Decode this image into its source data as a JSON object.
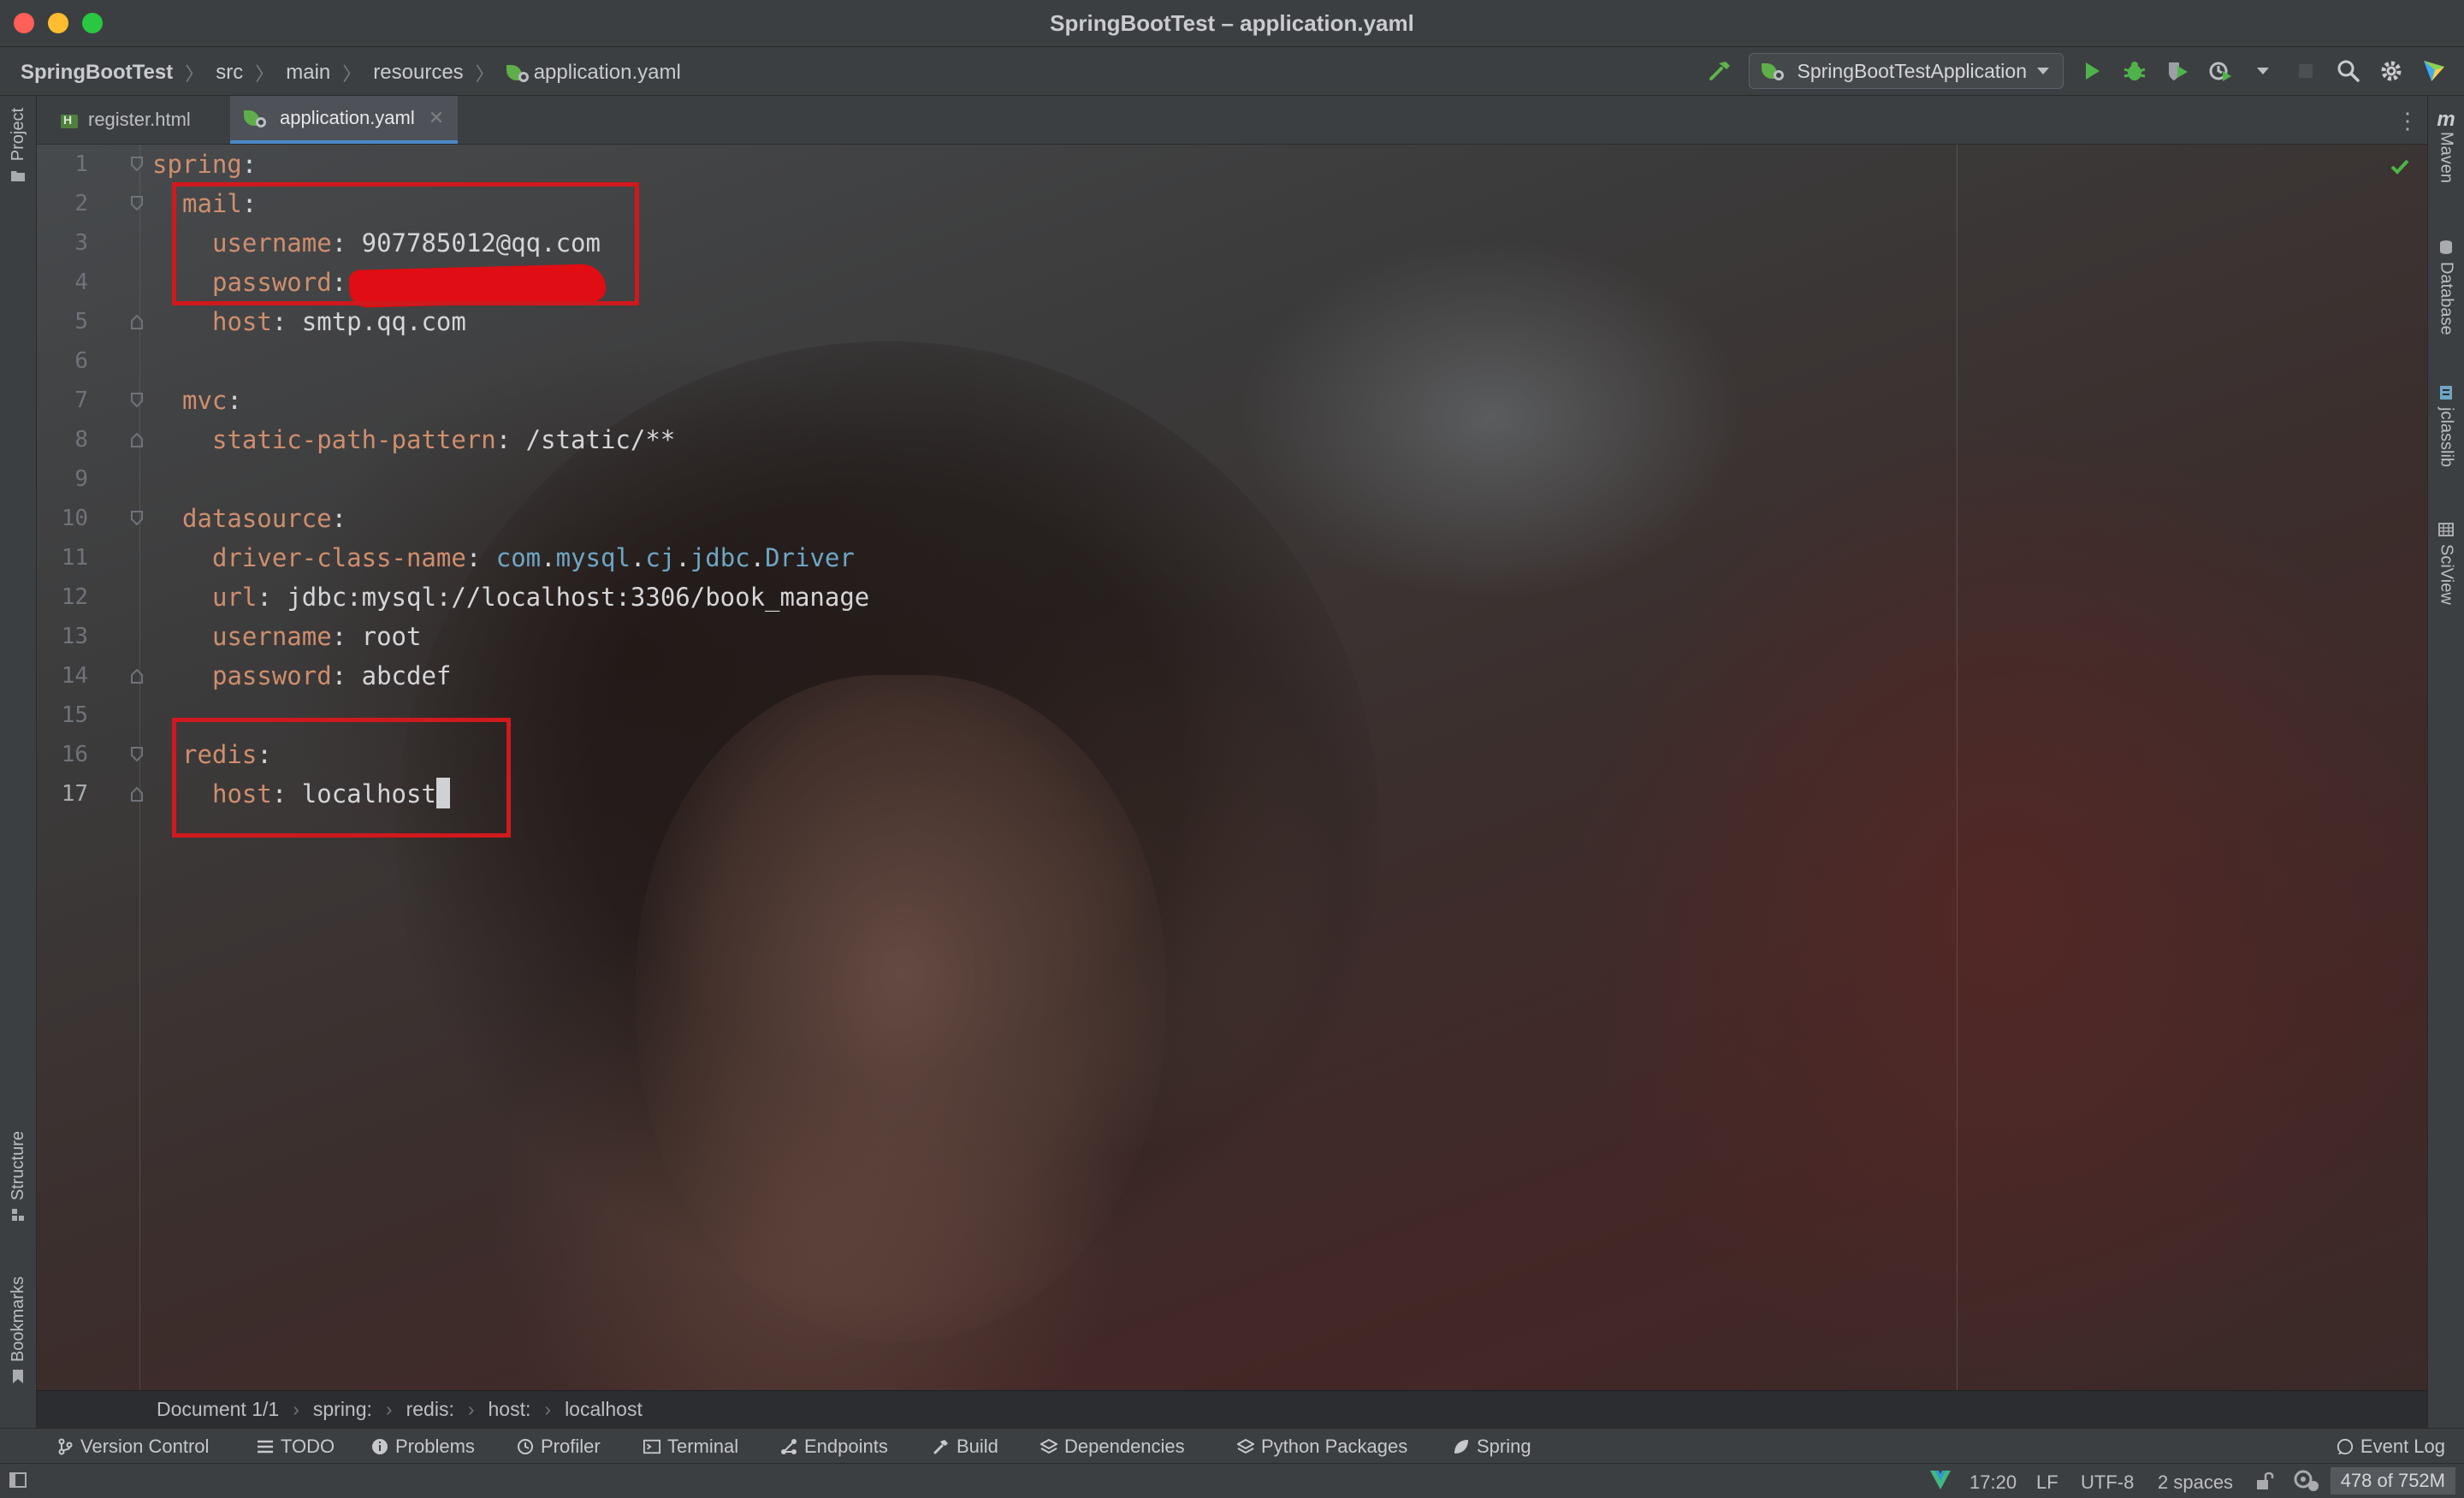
{
  "window": {
    "title": "SpringBootTest – application.yaml"
  },
  "navbar": {
    "breadcrumbs": [
      "SpringBootTest",
      "src",
      "main",
      "resources",
      "application.yaml"
    ],
    "run_config": "SpringBootTestApplication"
  },
  "left_tools": {
    "project": "Project",
    "structure": "Structure",
    "bookmarks": "Bookmarks"
  },
  "right_tools": {
    "maven": "Maven",
    "database": "Database",
    "jclasslib": "jclasslib",
    "sciview": "SciView"
  },
  "tabs": [
    {
      "label": "register.html",
      "active": false
    },
    {
      "label": "application.yaml",
      "active": true
    }
  ],
  "editor": {
    "line_numbers": [
      "1",
      "2",
      "3",
      "4",
      "5",
      "6",
      "7",
      "8",
      "9",
      "10",
      "11",
      "12",
      "13",
      "14",
      "15",
      "16",
      "17"
    ],
    "current_line": "17",
    "code": {
      "l1_key": "spring",
      "l2_key": "mail",
      "l3_key": "username",
      "l3_val": "907785012@qq.com",
      "l4_key": "password",
      "l4_val": "",
      "l5_key": "host",
      "l5_val": "smtp.qq.com",
      "l7_key": "mvc",
      "l8_key": "static-path-pattern",
      "l8_val": "/static/**",
      "l10_key": "datasource",
      "l11_key": "driver-class-name",
      "l11_val_parts": [
        "com",
        "mysql",
        "cj",
        "jdbc",
        "Driver"
      ],
      "l12_key": "url",
      "l12_val": "jdbc:mysql://localhost:3306/book_manage",
      "l13_key": "username",
      "l13_val": "root",
      "l14_key": "password",
      "l14_val": "abcdef",
      "l16_key": "redis",
      "l17_key": "host",
      "l17_val": "localhost",
      "colon": ":"
    },
    "colors": {
      "key": "#cf8e6d",
      "value": "#d5d6d9",
      "package": "#6fa6c4",
      "highlight_box": "#d0191d",
      "redaction": "#e00d14"
    }
  },
  "path_breadcrumb": [
    "Document 1/1",
    "spring:",
    "redis:",
    "host:",
    "localhost"
  ],
  "tool_windows": {
    "version_control": "Version Control",
    "todo": "TODO",
    "problems": "Problems",
    "profiler": "Profiler",
    "terminal": "Terminal",
    "endpoints": "Endpoints",
    "build": "Build",
    "dependencies": "Dependencies",
    "python_packages": "Python Packages",
    "spring": "Spring",
    "event_log": "Event Log"
  },
  "status": {
    "position": "17:20",
    "line_sep": "LF",
    "encoding": "UTF-8",
    "indent": "2 spaces",
    "memory": "478 of 752M"
  }
}
